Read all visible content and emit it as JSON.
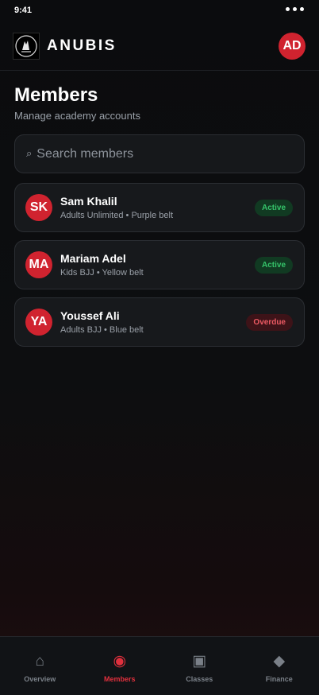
{
  "status_bar": {
    "time": "9:41"
  },
  "app": {
    "brand": "ANUBIS",
    "user_initials": "AD"
  },
  "page": {
    "title": "Members",
    "subtitle": "Manage academy accounts"
  },
  "search": {
    "placeholder": "Search members",
    "value": "",
    "icon": "search-icon"
  },
  "members": [
    {
      "initials": "SK",
      "name": "Sam Khalil",
      "detail": "Adults Unlimited • Purple belt",
      "status": "Active"
    },
    {
      "initials": "MA",
      "name": "Mariam Adel",
      "detail": "Kids BJJ • Yellow belt",
      "status": "Active"
    },
    {
      "initials": "YA",
      "name": "Youssef Ali",
      "detail": "Adults BJJ • Blue belt",
      "status": "Overdue"
    }
  ],
  "tabs": [
    {
      "label": "Overview",
      "icon": "home-icon",
      "glyph": "⌂"
    },
    {
      "label": "Members",
      "icon": "members-icon",
      "glyph": "◉",
      "selected": true
    },
    {
      "label": "Classes",
      "icon": "classes-icon",
      "glyph": "▣"
    },
    {
      "label": "Finance",
      "icon": "finance-icon",
      "glyph": "◆"
    }
  ],
  "colors": {
    "accent": "#d0232f",
    "active": "#35c46a",
    "overdue": "#ec5a63"
  }
}
